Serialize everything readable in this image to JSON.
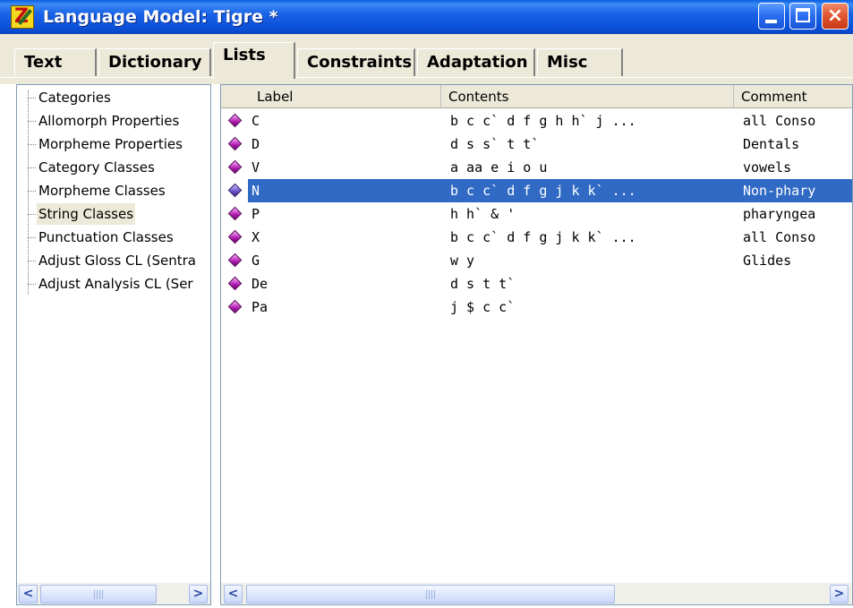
{
  "window": {
    "title": "Language Model: Tigre *",
    "controls": {
      "minimize": "minimize",
      "maximize": "maximize",
      "close": "×"
    }
  },
  "tabs": [
    {
      "label": "Text"
    },
    {
      "label": "Dictionary"
    },
    {
      "label": "Lists",
      "active": true
    },
    {
      "label": "Constraints"
    },
    {
      "label": "Adaptation"
    },
    {
      "label": "Misc"
    }
  ],
  "tree": {
    "items": [
      {
        "label": "Categories"
      },
      {
        "label": "Allomorph Properties"
      },
      {
        "label": "Morpheme Properties"
      },
      {
        "label": "Category Classes"
      },
      {
        "label": "Morpheme Classes"
      },
      {
        "label": "String Classes",
        "selected": true
      },
      {
        "label": "Punctuation Classes"
      },
      {
        "label": "Adjust Gloss CL (Sentra"
      },
      {
        "label": "Adjust Analysis CL (Ser"
      }
    ]
  },
  "table": {
    "columns": [
      "Label",
      "Contents",
      "Comment"
    ],
    "rows": [
      {
        "label": "C",
        "contents": "b c c` d f g h h` j ...",
        "comment": "all Conso"
      },
      {
        "label": "D",
        "contents": "d s s` t t`",
        "comment": "Dentals"
      },
      {
        "label": "V",
        "contents": "a aa e i o u",
        "comment": "vowels"
      },
      {
        "label": "N",
        "contents": "b c c` d f g j k k` ...",
        "comment": "Non-phary",
        "selected": true
      },
      {
        "label": "P",
        "contents": "h h` & '",
        "comment": "pharyngea"
      },
      {
        "label": "X",
        "contents": "b c c` d f g j k k` ...",
        "comment": "all Conso"
      },
      {
        "label": "G",
        "contents": "w y",
        "comment": "Glides"
      },
      {
        "label": "De",
        "contents": "d s t t`",
        "comment": ""
      },
      {
        "label": "Pa",
        "contents": "j $ c c`",
        "comment": ""
      }
    ]
  },
  "scroll": {
    "left_arrow": "<",
    "right_arrow": ">"
  },
  "colors": {
    "selection": "#316ac5",
    "titlebar": "#0a4fd6",
    "chrome": "#ece9d8"
  }
}
